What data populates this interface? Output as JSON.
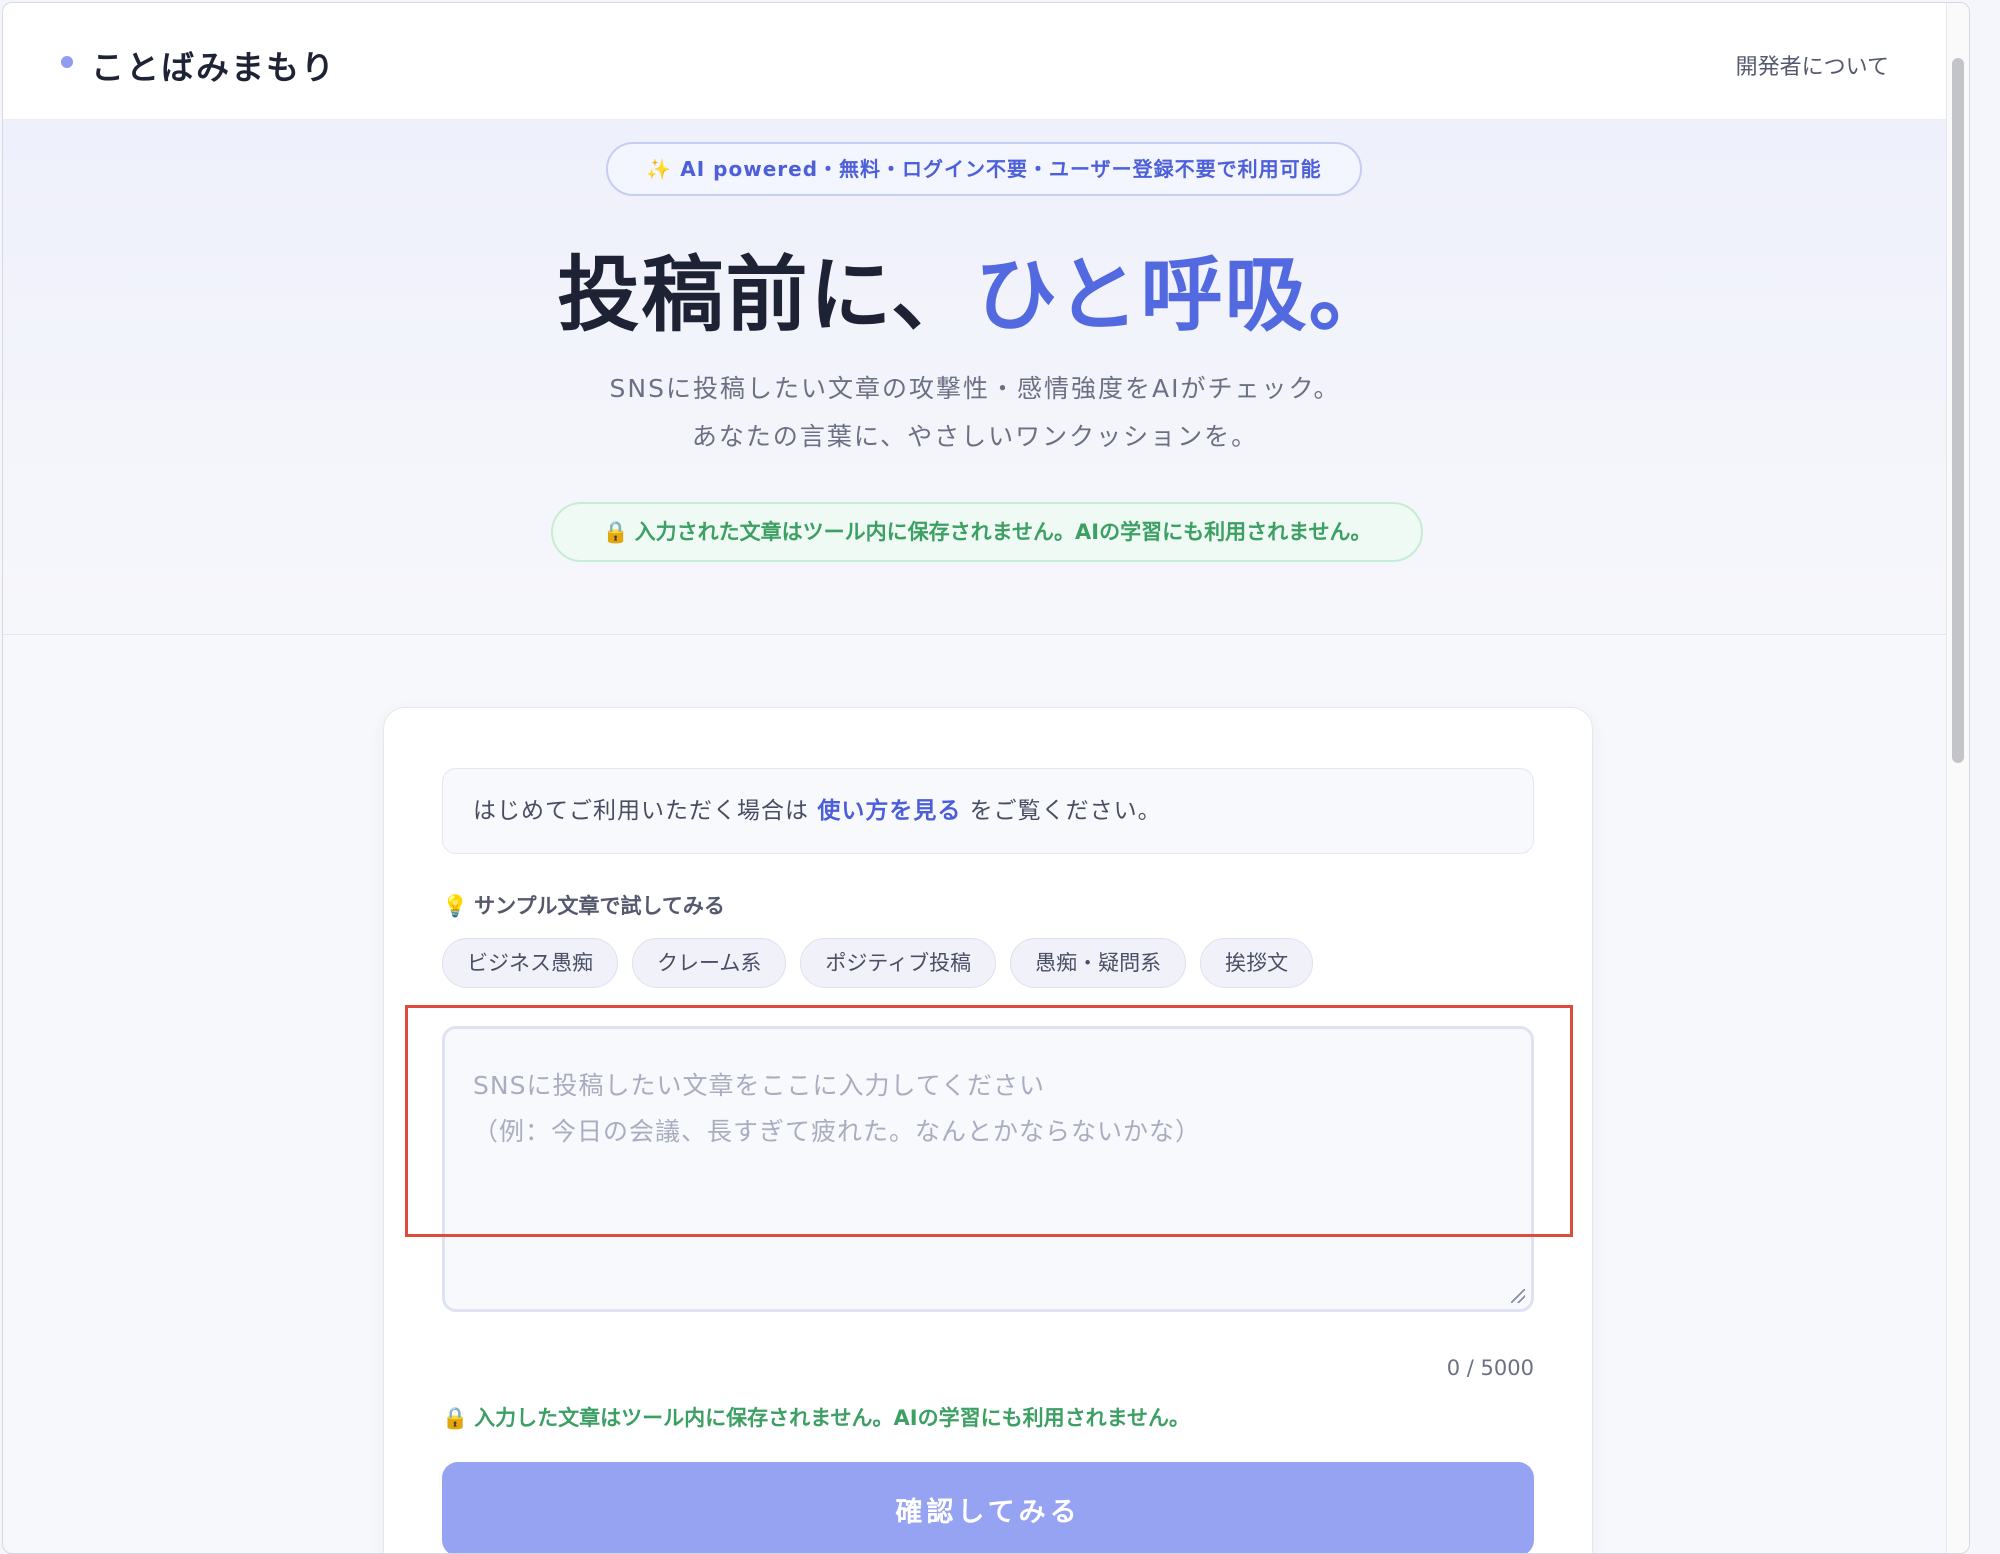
{
  "header": {
    "logo": "ことばみまもり",
    "about_link": "開発者について"
  },
  "hero": {
    "badge_icon": "✨",
    "badge": "AI powered・無料・ログイン不要・ユーザー登録不要で利用可能",
    "title_main": "投稿前に、",
    "title_accent": "ひと呼吸。",
    "subtitle_line1": "SNSに投稿したい文章の攻撃性・感情強度をAIがチェック。",
    "subtitle_line2": "あなたの言葉に、やさしいワンクッションを。",
    "privacy": "入力された文章はツール内に保存されません。AIの学習にも利用されません。"
  },
  "card": {
    "notice_prefix": "はじめてご利用いただく場合は",
    "notice_link": "使い方を見る",
    "notice_suffix": "をご覧ください。",
    "sample_heading": "サンプル文章で試してみる",
    "chips": [
      "ビジネス愚痴",
      "クレーム系",
      "ポジティブ投稿",
      "愚痴・疑問系",
      "挨拶文"
    ],
    "textarea_placeholder_line1": "SNSに投稿したい文章をここに入力してください",
    "textarea_placeholder_line2": "（例：今日の会議、長すぎて疲れた。なんとかならないかな）",
    "char_count": "0 / 5000",
    "privacy_note": "入力した文章はツール内に保存されません。AIの学習にも利用されません。",
    "submit": "確認してみる"
  },
  "colors": {
    "accent": "#5369e0",
    "success": "#3c9f63",
    "button": "#95a3f2",
    "highlight": "#e04a3a"
  },
  "icons": {
    "badge": "sparkles-icon",
    "privacy": "lock-icon",
    "sample": "lightbulb-icon"
  }
}
